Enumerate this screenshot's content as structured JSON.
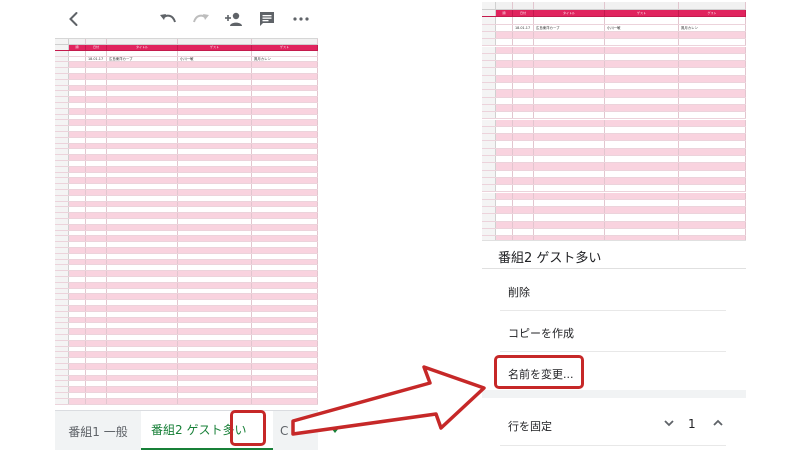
{
  "left_screen": {
    "toolbar_icons": [
      "back-arrow-icon",
      "undo-icon",
      "redo-icon",
      "add-person-icon",
      "comment-icon",
      "more-icon"
    ],
    "sheet": {
      "header_cells": [
        "順",
        "日付",
        "タイトル",
        "ゲスト",
        "ゲスト"
      ],
      "data_row": [
        "18.01.17",
        "広島東洋カープ",
        "小川一敏",
        "鳳月カレン"
      ],
      "row_count": 62
    },
    "tabs": [
      {
        "label": "番組1 一般"
      },
      {
        "label": "番組2 ゲスト多い"
      },
      {
        "label": "C"
      }
    ]
  },
  "right_screen": {
    "sheet": {
      "header_cells": [
        "順",
        "日付",
        "タイトル",
        "ゲスト",
        "ゲスト"
      ],
      "data_row": [
        "18.01.17",
        "広島東洋カープ",
        "小川一敏",
        "鳳月カレン"
      ],
      "row_count": 32
    },
    "menu": {
      "title": "番組2 ゲスト多い",
      "items": [
        {
          "label": "削除"
        },
        {
          "label": "コピーを作成"
        },
        {
          "label": "名前を変更..."
        }
      ],
      "freeze": {
        "label": "行を固定",
        "value": "1"
      }
    }
  },
  "colors": {
    "header_pink": "#e0245e",
    "row_pink": "#f9d3df",
    "active_tab_green": "#188038",
    "highlight_red": "#c62828"
  }
}
